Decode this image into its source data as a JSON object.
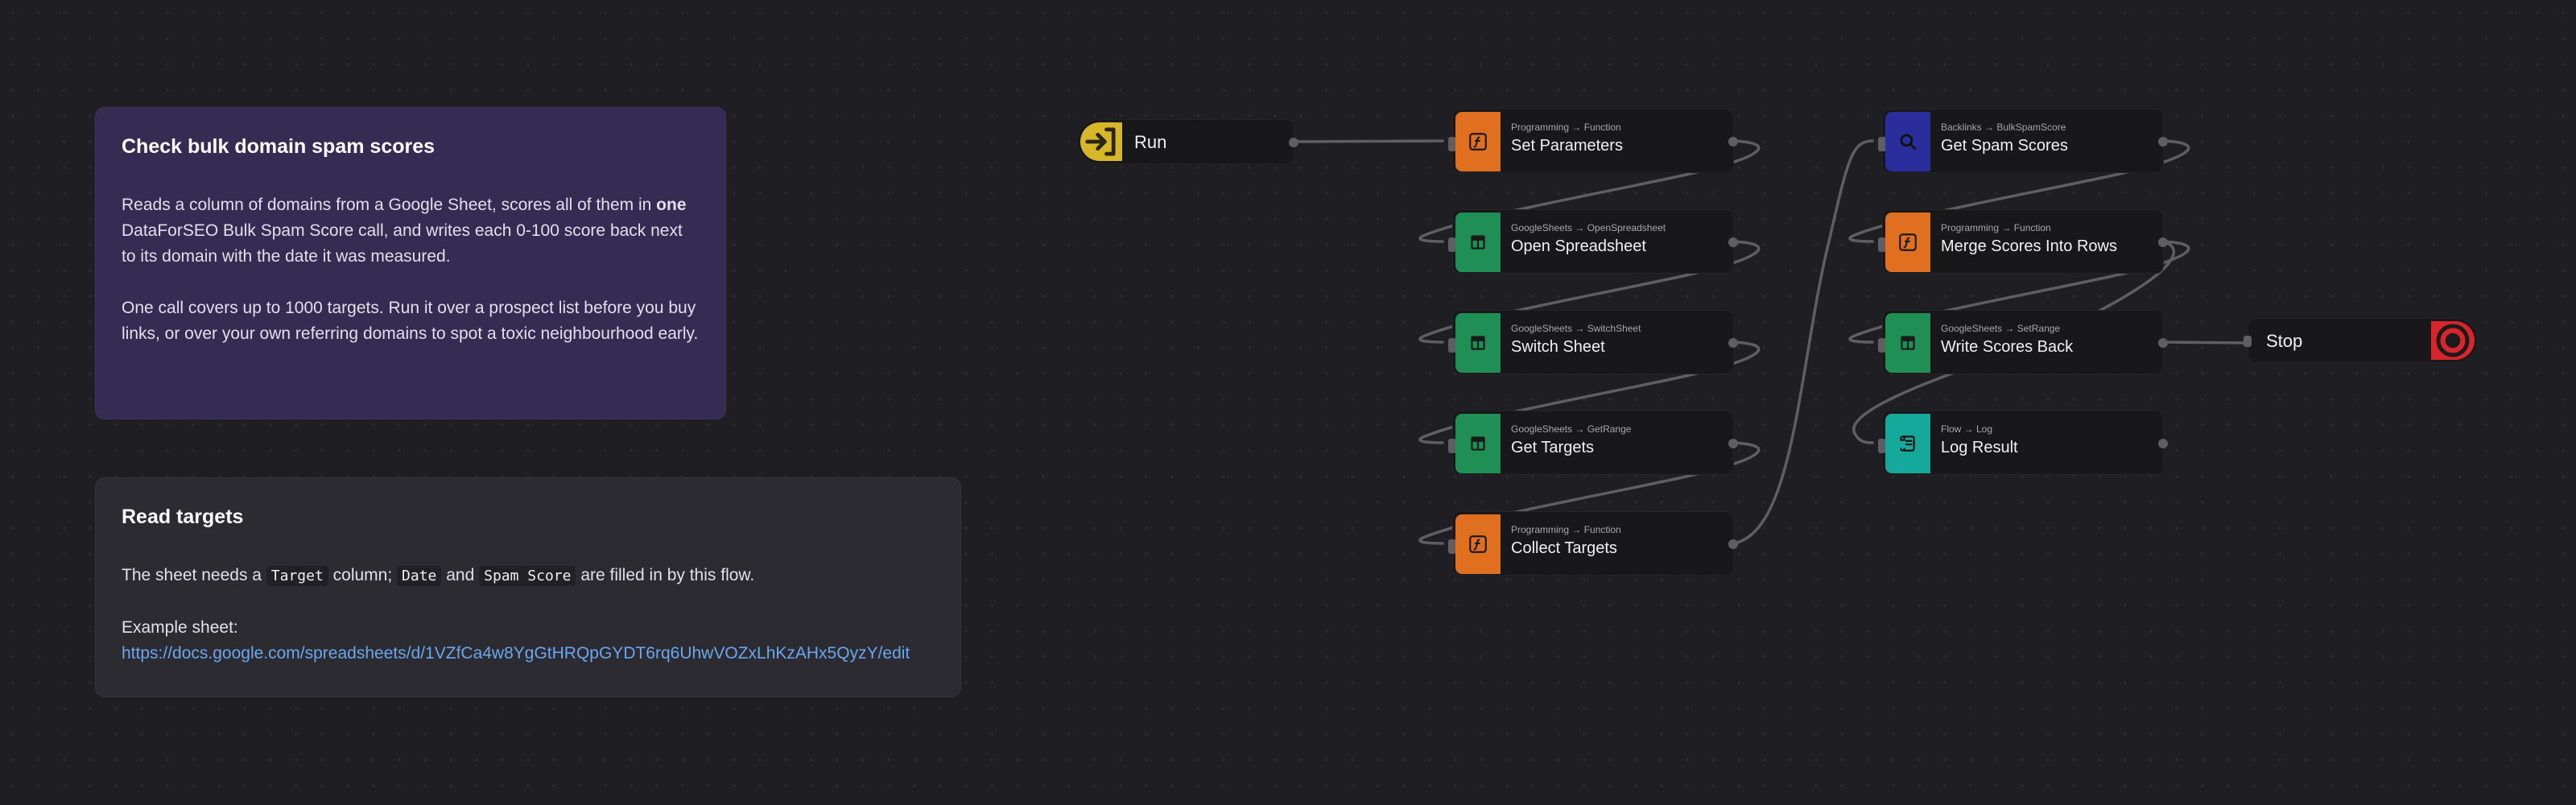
{
  "notes": {
    "intro": {
      "title": "Check bulk domain spam scores",
      "p1_before": "Reads a column of domains from a Google Sheet, scores all of them in ",
      "p1_bold": "one",
      "p1_after": " DataForSEO Bulk Spam Score call, and writes each 0-100 score back next to its domain with the date it was measured.",
      "p2": "One call covers up to 1000 targets. Run it over a prospect list before you buy links, or over your own referring domains to spot a toxic neighbourhood early."
    },
    "targets": {
      "title": "Read targets",
      "p1_a": "The sheet needs a ",
      "code_target": "Target",
      "p1_b": " column; ",
      "code_date": "Date",
      "p1_c": " and ",
      "code_spam": "Spam Score",
      "p1_d": " are filled in by this flow.",
      "example_label": "Example sheet:",
      "example_link": "https://docs.google.com/spreadsheets/d/1VZfCa4w8YgGtHRQpGYDT6rq6UhwVOZxLhKzAHx5QyzY/edit"
    }
  },
  "colors": {
    "programming": "#e07020",
    "sheets": "#1f8f55",
    "backlinks": "#2a2e9c",
    "flow": "#15a99b",
    "run": "#d8b62a",
    "stop": "#d6252b"
  },
  "nodes": {
    "run": {
      "title": "Run",
      "icon": "enter-icon"
    },
    "stop": {
      "title": "Stop",
      "icon": "stop-circle-icon"
    },
    "set_parameters": {
      "sub": "Programming → Function",
      "title": "Set Parameters",
      "icon": "function-icon"
    },
    "open_spreadsheet": {
      "sub": "GoogleSheets → OpenSpreadsheet",
      "title": "Open Spreadsheet",
      "icon": "spreadsheet-icon"
    },
    "switch_sheet": {
      "sub": "GoogleSheets → SwitchSheet",
      "title": "Switch Sheet",
      "icon": "spreadsheet-icon"
    },
    "get_targets": {
      "sub": "GoogleSheets → GetRange",
      "title": "Get Targets",
      "icon": "spreadsheet-icon"
    },
    "collect_targets": {
      "sub": "Programming → Function",
      "title": "Collect Targets",
      "icon": "function-icon"
    },
    "get_spam_scores": {
      "sub": "Backlinks → BulkSpamScore",
      "title": "Get Spam Scores",
      "icon": "search-icon"
    },
    "merge_scores": {
      "sub": "Programming → Function",
      "title": "Merge Scores Into Rows",
      "icon": "function-icon"
    },
    "write_scores": {
      "sub": "GoogleSheets → SetRange",
      "title": "Write Scores Back",
      "icon": "spreadsheet-icon"
    },
    "log_result": {
      "sub": "Flow → Log",
      "title": "Log Result",
      "icon": "log-icon"
    }
  }
}
